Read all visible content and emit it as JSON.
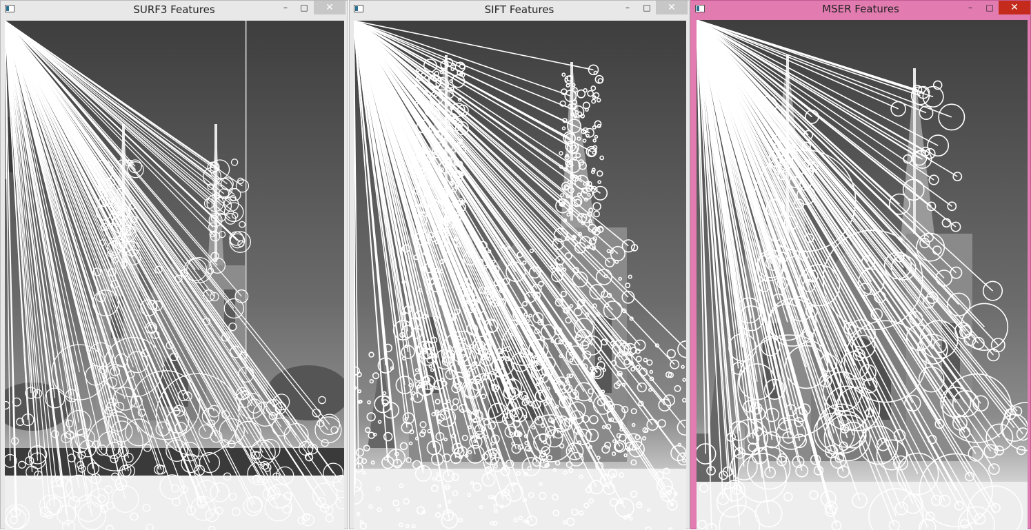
{
  "windows": [
    {
      "title": "SURF3 Features",
      "minimize": "–",
      "maximize": "□",
      "close": "✕"
    },
    {
      "title": "SIFT Features",
      "minimize": "–",
      "maximize": "□",
      "close": "✕"
    },
    {
      "title": "MSER Features",
      "minimize": "–",
      "maximize": "□",
      "close": "✕"
    }
  ],
  "colors": {
    "active_border": "#e27bb0",
    "inactive_border": "#e8e8e8",
    "keypoint": "#ffffff"
  },
  "icons": {
    "window_icon": "app-window-icon",
    "minimize": "minimize-icon",
    "maximize": "maximize-icon",
    "close": "close-icon"
  }
}
